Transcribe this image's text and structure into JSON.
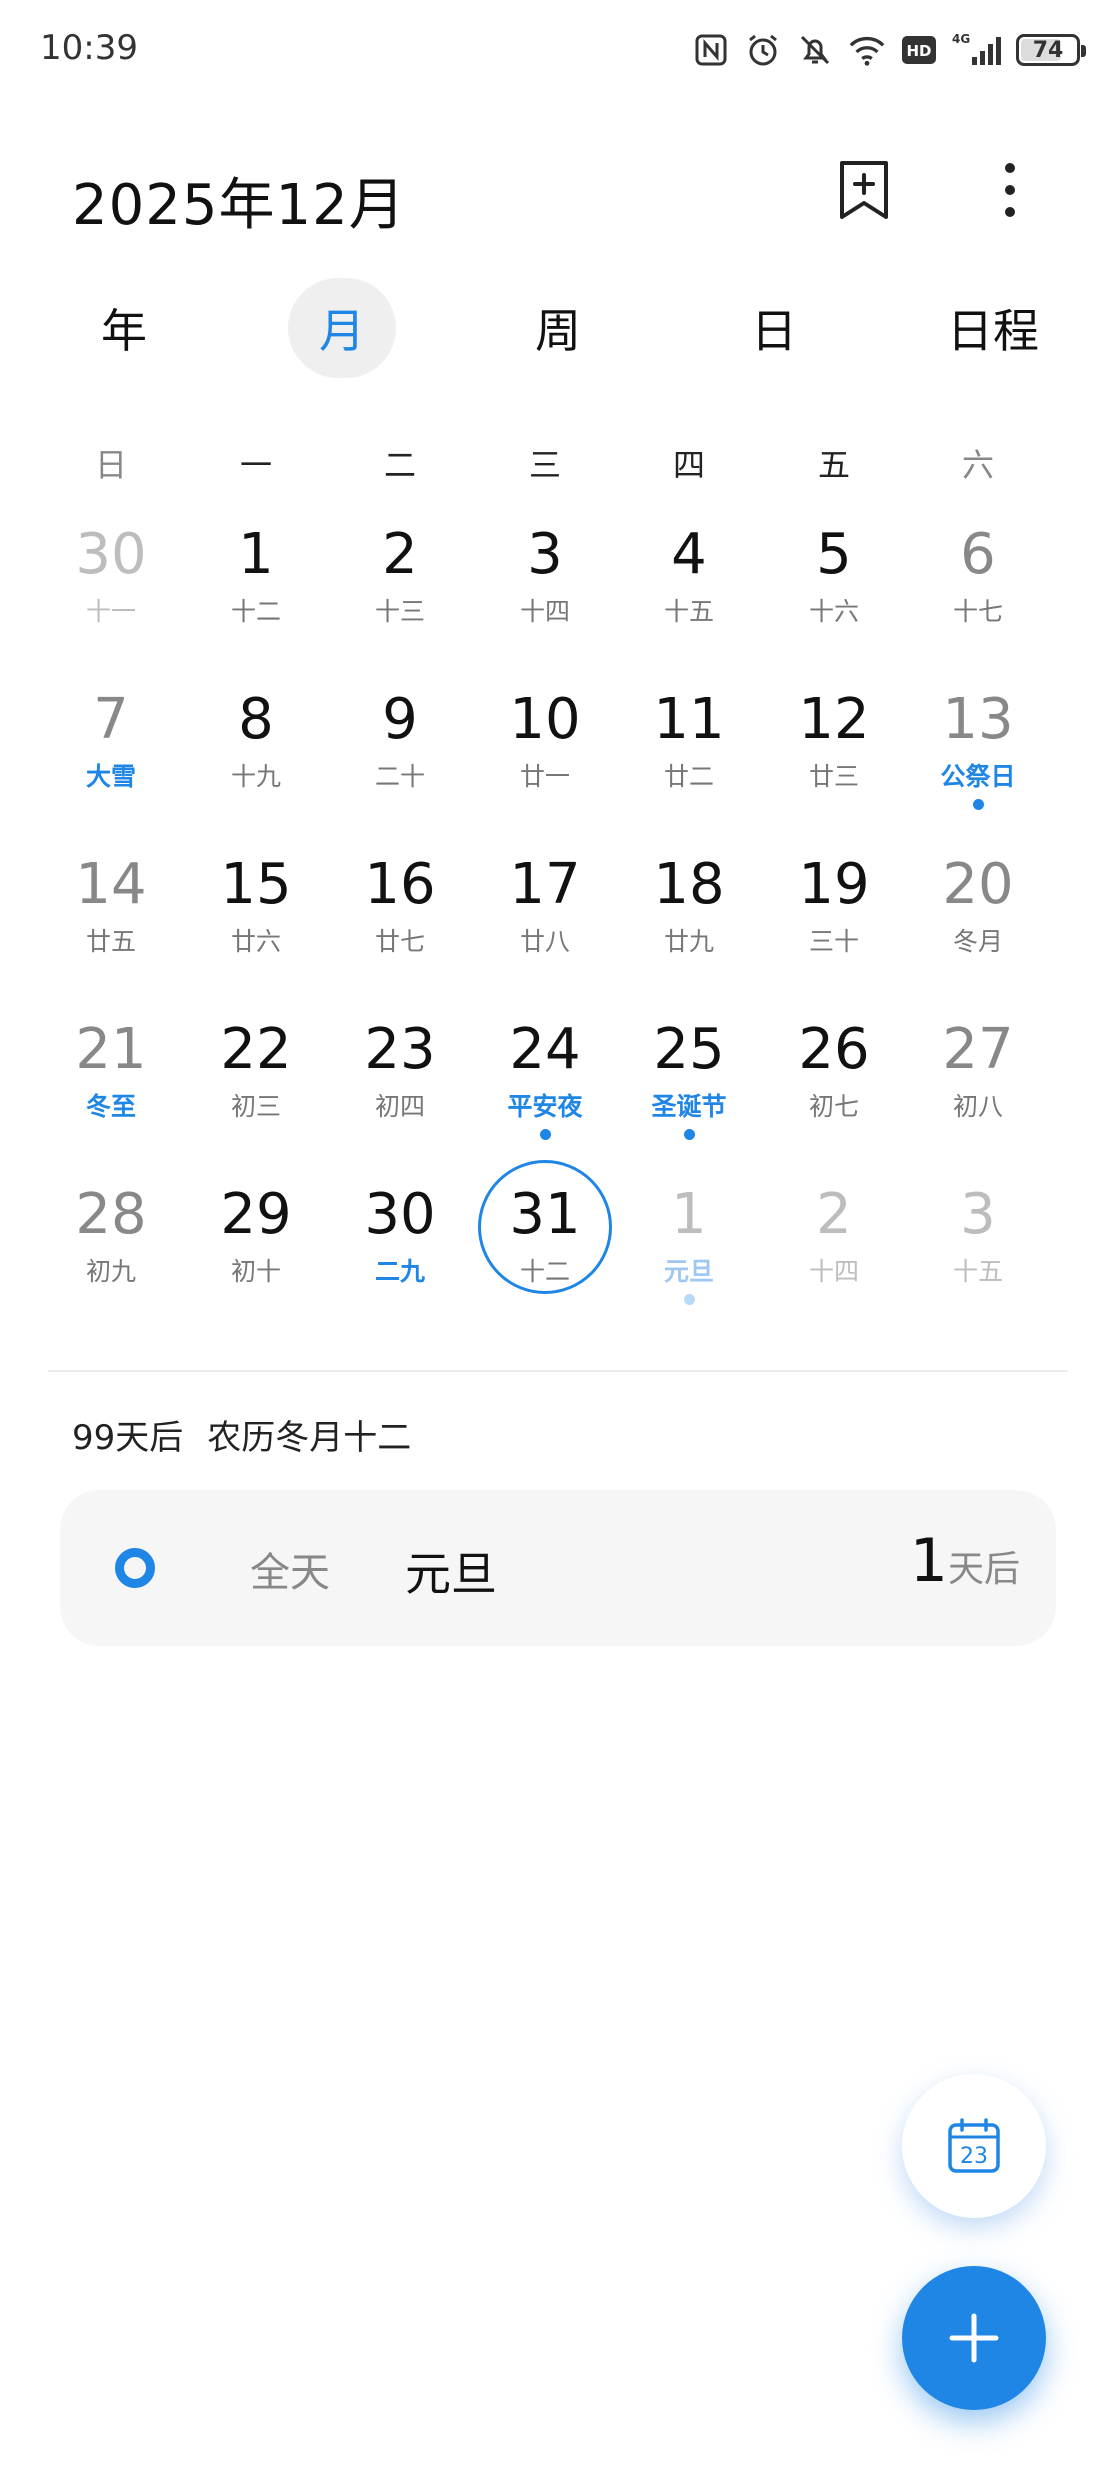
{
  "status_bar": {
    "time": "10:39",
    "network": "4G",
    "battery_level": 74,
    "battery_text": "74",
    "hd_label": "HD"
  },
  "header": {
    "month_title": "2025年12月"
  },
  "tabs": [
    {
      "label": "年",
      "active": false
    },
    {
      "label": "月",
      "active": true
    },
    {
      "label": "周",
      "active": false
    },
    {
      "label": "日",
      "active": false
    },
    {
      "label": "日程",
      "active": false
    }
  ],
  "weekdays": [
    "日",
    "一",
    "二",
    "三",
    "四",
    "五",
    "六"
  ],
  "calendar": {
    "weeks": [
      [
        {
          "day": "30",
          "lunar": "十一",
          "other_month": true
        },
        {
          "day": "1",
          "lunar": "十二"
        },
        {
          "day": "2",
          "lunar": "十三"
        },
        {
          "day": "3",
          "lunar": "十四"
        },
        {
          "day": "4",
          "lunar": "十五"
        },
        {
          "day": "5",
          "lunar": "十六"
        },
        {
          "day": "6",
          "lunar": "十七"
        }
      ],
      [
        {
          "day": "7",
          "lunar": "大雪",
          "highlight": true
        },
        {
          "day": "8",
          "lunar": "十九"
        },
        {
          "day": "9",
          "lunar": "二十"
        },
        {
          "day": "10",
          "lunar": "廿一"
        },
        {
          "day": "11",
          "lunar": "廿二"
        },
        {
          "day": "12",
          "lunar": "廿三"
        },
        {
          "day": "13",
          "lunar": "公祭日",
          "highlight": true,
          "has_event": true
        }
      ],
      [
        {
          "day": "14",
          "lunar": "廿五"
        },
        {
          "day": "15",
          "lunar": "廿六"
        },
        {
          "day": "16",
          "lunar": "廿七"
        },
        {
          "day": "17",
          "lunar": "廿八"
        },
        {
          "day": "18",
          "lunar": "廿九"
        },
        {
          "day": "19",
          "lunar": "三十"
        },
        {
          "day": "20",
          "lunar": "冬月"
        }
      ],
      [
        {
          "day": "21",
          "lunar": "冬至",
          "highlight": true
        },
        {
          "day": "22",
          "lunar": "初三"
        },
        {
          "day": "23",
          "lunar": "初四"
        },
        {
          "day": "24",
          "lunar": "平安夜",
          "highlight": true,
          "has_event": true
        },
        {
          "day": "25",
          "lunar": "圣诞节",
          "highlight": true,
          "has_event": true
        },
        {
          "day": "26",
          "lunar": "初七"
        },
        {
          "day": "27",
          "lunar": "初八"
        }
      ],
      [
        {
          "day": "28",
          "lunar": "初九"
        },
        {
          "day": "29",
          "lunar": "初十"
        },
        {
          "day": "30",
          "lunar": "二九",
          "highlight": true
        },
        {
          "day": "31",
          "lunar": "十二",
          "today": true
        },
        {
          "day": "1",
          "lunar": "元旦",
          "highlight": true,
          "has_event": true,
          "other_month": true
        },
        {
          "day": "2",
          "lunar": "十四",
          "other_month": true
        },
        {
          "day": "3",
          "lunar": "十五",
          "other_month": true
        }
      ]
    ]
  },
  "selected_info": {
    "days_after": "99天后",
    "lunar_date": "农历冬月十二"
  },
  "event": {
    "all_day": "全天",
    "title": "元旦",
    "count": "1",
    "count_unit": "天后",
    "accent_color": "#1f86e5"
  },
  "fab_today": {
    "date_number": "23"
  },
  "icons": {
    "add_bookmark": "bookmark-add-icon",
    "more": "more-vertical-icon",
    "today": "calendar-today-icon",
    "add": "plus-icon"
  }
}
